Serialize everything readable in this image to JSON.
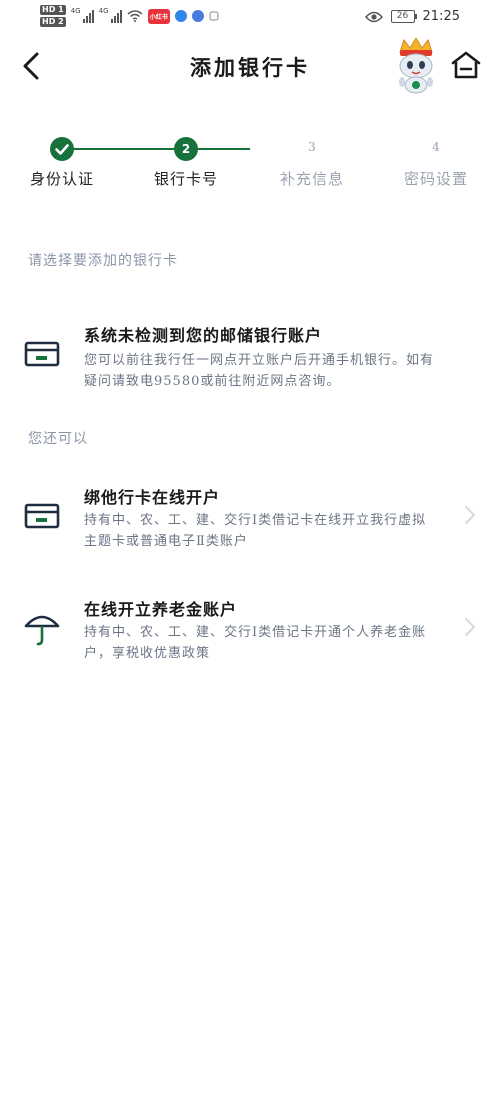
{
  "status_bar": {
    "hd1": "HD 1",
    "hd2": "HD 2",
    "net1": "4G",
    "net2": "4G",
    "app_badge": "小红书",
    "battery": "26",
    "time": "21:25"
  },
  "header": {
    "title": "添加银行卡"
  },
  "steps": [
    {
      "number": "1",
      "label": "身份认证",
      "state": "done"
    },
    {
      "number": "2",
      "label": "银行卡号",
      "state": "current"
    },
    {
      "number": "3",
      "label": "补充信息",
      "state": "pending"
    },
    {
      "number": "4",
      "label": "密码设置",
      "state": "pending"
    }
  ],
  "select_section": {
    "label": "请选择要添加的银行卡",
    "notice_title": "系统未检测到您的邮储银行账户",
    "notice_desc": "您可以前往我行任一网点开立账户后开通手机银行。如有疑问请致电95580或前往附近网点咨询。"
  },
  "also_section": {
    "label": "您还可以",
    "items": [
      {
        "title": "绑他行卡在线开户",
        "desc": "持有中、农、工、建、交行Ⅰ类借记卡在线开立我行虚拟主题卡或普通电子Ⅱ类账户",
        "icon": "bank-card-icon"
      },
      {
        "title": "在线开立养老金账户",
        "desc": "持有中、农、工、建、交行Ⅰ类借记卡开通个人养老金账户，享税收优惠政策",
        "icon": "umbrella-icon"
      }
    ]
  },
  "colors": {
    "brand_green": "#17713c",
    "muted_text": "#8a96a8",
    "pending_step": "#9aa3b0"
  }
}
